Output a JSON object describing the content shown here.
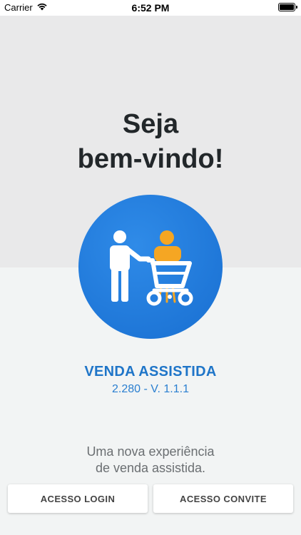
{
  "status_bar": {
    "carrier": "Carrier",
    "time": "6:52 PM"
  },
  "welcome": {
    "line1": "Seja",
    "line2": "bem-vindo!"
  },
  "app": {
    "name": "VENDA ASSISTIDA",
    "version": "2.280 - V. 1.1.1",
    "logo_icon": "assisted-shopping-cart-icon",
    "brand_color": "#1f75c8"
  },
  "tagline": {
    "line1": "Uma nova experiência",
    "line2": "de venda assistida."
  },
  "buttons": {
    "login": "ACESSO LOGIN",
    "convite": "ACESSO CONVITE"
  }
}
